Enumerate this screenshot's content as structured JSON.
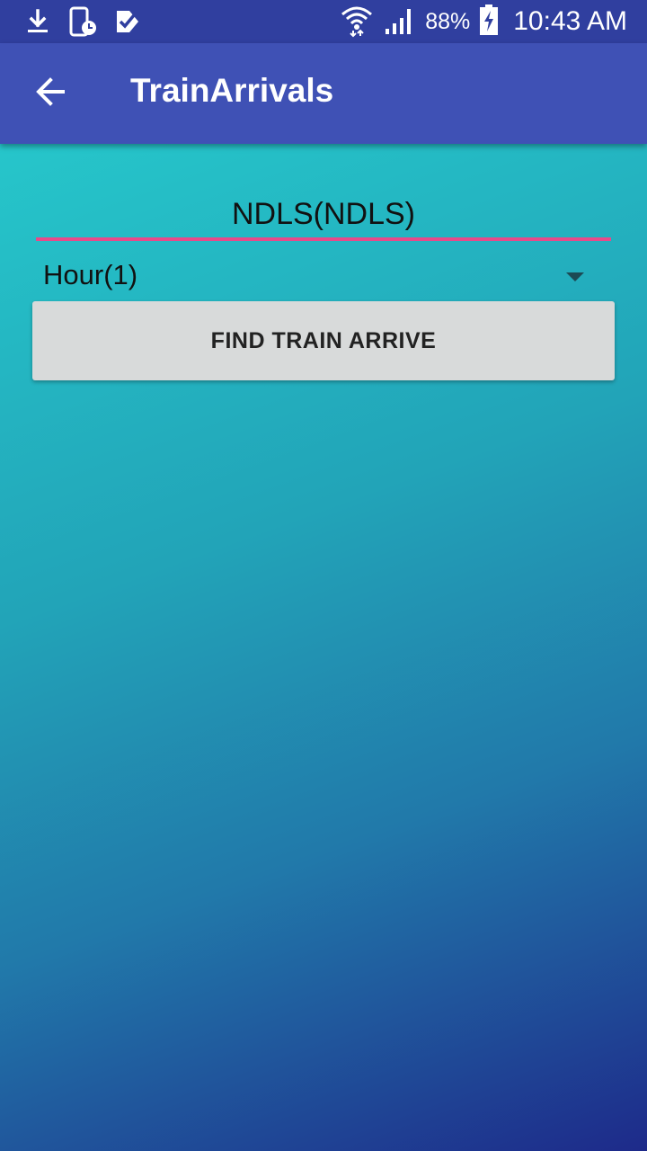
{
  "status_bar": {
    "left_icons": [
      "download-icon",
      "phone-clock-icon",
      "checkmark-app-icon"
    ],
    "wifi_icon": "wifi-icon",
    "signal_icon": "signal-icon",
    "battery_percent": "88%",
    "battery_icon": "battery-charging-icon",
    "time": "10:43 AM"
  },
  "app_bar": {
    "back_icon": "arrow-left-icon",
    "title": "TrainArrivals"
  },
  "form": {
    "station_value": "NDLS(NDLS)",
    "hour_selected": "Hour(1)",
    "find_button_label": "FIND TRAIN ARRIVE"
  },
  "colors": {
    "status_bar": "#303f9f",
    "app_bar": "#3f51b5",
    "accent_underline": "#e84a8a",
    "button_bg": "#d8dada",
    "gradient_top": "#27d0d0",
    "gradient_bottom": "#1e2a8a"
  }
}
